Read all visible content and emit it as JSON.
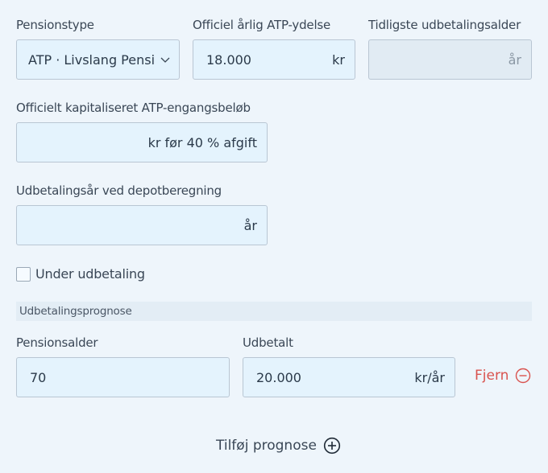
{
  "pension_type": {
    "label": "Pensionstype",
    "value": "ATP · Livslang Pension"
  },
  "atp_annual": {
    "label": "Officiel årlig ATP-ydelse",
    "value": "18.000",
    "suffix": "kr"
  },
  "earliest_age": {
    "label": "Tidligste udbetalingsalder",
    "value": "",
    "suffix": "år"
  },
  "lump_sum": {
    "label": "Officielt kapitaliseret ATP-engangsbeløb",
    "value": "",
    "suffix": "kr før 40 % afgift"
  },
  "payout_years": {
    "label": "Udbetalingsår ved depotberegning",
    "value": "",
    "suffix": "år"
  },
  "under_payout": {
    "label": "Under udbetaling",
    "checked": false
  },
  "forecast": {
    "section_title": "Udbetalingsprognose",
    "age_label": "Pensionsalder",
    "age_value": "70",
    "paid_label": "Udbetalt",
    "paid_value": "20.000",
    "paid_suffix": "kr/år",
    "remove_label": "Fjern",
    "add_label": "Tilføj prognose"
  },
  "colors": {
    "field_bg": "#e4f3fd",
    "danger": "#d9534f",
    "page_bg": "#eef5fb"
  },
  "icons": {
    "select": "chevron-down-icon",
    "remove": "minus-circle-icon",
    "add": "plus-circle-icon"
  }
}
